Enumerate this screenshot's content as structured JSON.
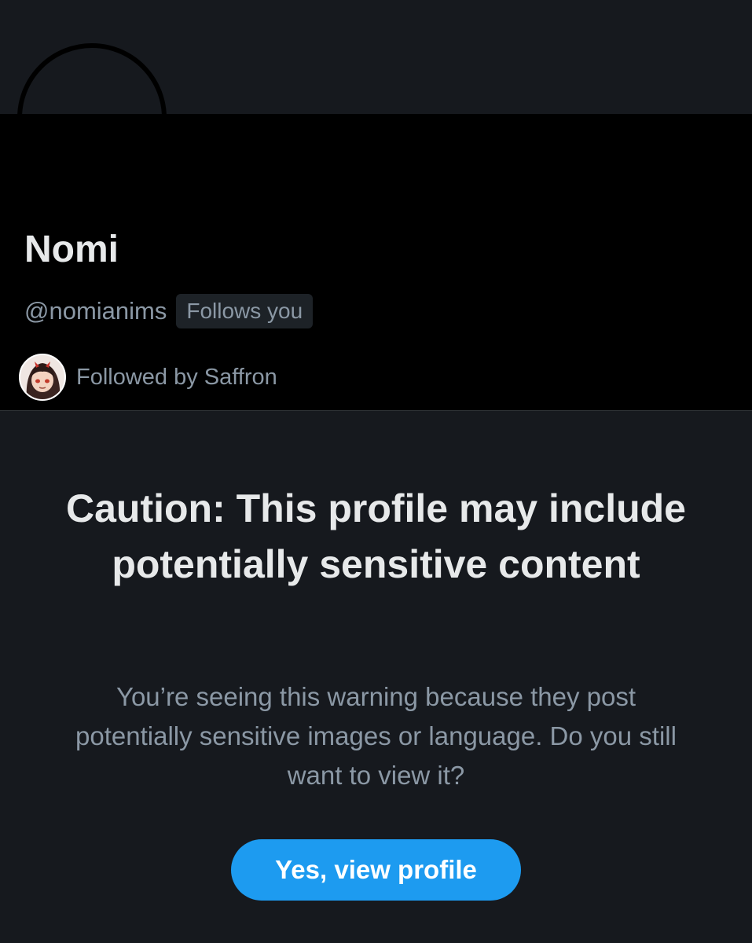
{
  "profile": {
    "display_name": "Nomi",
    "handle": "@nomianims",
    "follows_you_badge": "Follows you",
    "followed_by": "Followed by Saffron"
  },
  "warning": {
    "title": "Caution: This profile may include potentially sensitive content",
    "body": "You’re seeing this warning because they post potentially sensitive images or language. Do you still want to view it?",
    "button_label": "Yes, view profile"
  },
  "colors": {
    "background": "#16191e",
    "profile_area": "#000000",
    "primary_text": "#e7e9ea",
    "secondary_text": "#8b98a5",
    "accent": "#1d9bf0"
  },
  "icons": {
    "follower_avatar": "follower-avatar-image"
  }
}
